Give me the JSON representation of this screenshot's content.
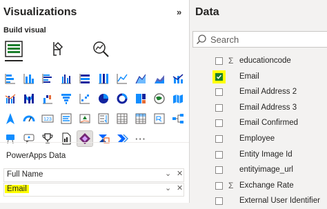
{
  "visualizations": {
    "title": "Visualizations",
    "collapse_glyph": "»",
    "build_label": "Build visual",
    "visual_name": "PowerApps Data",
    "more_glyph": "···",
    "wells": [
      {
        "name": "Full Name",
        "highlighted": false
      },
      {
        "name": "Email",
        "highlighted": true
      }
    ],
    "well_chevron": "⌄",
    "well_remove": "✕",
    "selected_visual_icon": "powerapps-icon"
  },
  "data": {
    "title": "Data",
    "search_placeholder": "Search",
    "fields": [
      {
        "name": "educationcode",
        "sigma": true,
        "checked": false
      },
      {
        "name": "Email",
        "sigma": false,
        "checked": true
      },
      {
        "name": "Email Address 2",
        "sigma": false,
        "checked": false
      },
      {
        "name": "Email Address 3",
        "sigma": false,
        "checked": false
      },
      {
        "name": "Email Confirmed",
        "sigma": false,
        "checked": false
      },
      {
        "name": "Employee",
        "sigma": false,
        "checked": false
      },
      {
        "name": "Entity Image Id",
        "sigma": false,
        "checked": false
      },
      {
        "name": "entityimage_url",
        "sigma": false,
        "checked": false
      },
      {
        "name": "Exchange Rate",
        "sigma": true,
        "checked": false
      },
      {
        "name": "External User Identifier",
        "sigma": false,
        "checked": false
      }
    ],
    "sigma_glyph": "Σ"
  },
  "colors": {
    "accent_yellow": "#ffff00",
    "check_green": "#1b7f2d",
    "powerapps_purple": "#742774",
    "viz_blue": "#118dff"
  }
}
